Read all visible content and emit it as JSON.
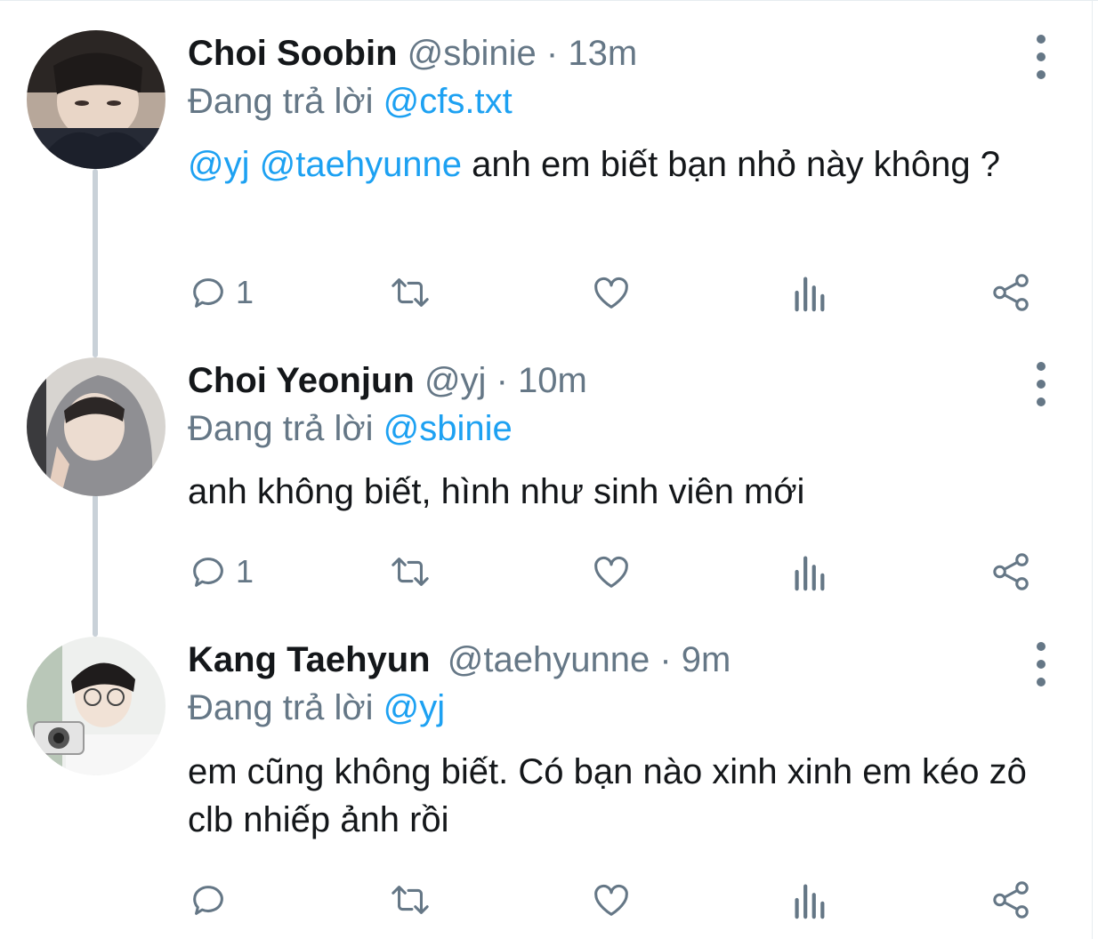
{
  "labels": {
    "replying_prefix": "Đang trả lời",
    "dot": "·"
  },
  "colors": {
    "mention": "#1da1f2",
    "secondary": "#657786",
    "thread_line": "#c9d1d8"
  },
  "tweets": [
    {
      "name": "Choi Soobin",
      "handle": "@sbinie",
      "time": "13m",
      "replying_to": "@cfs.txt",
      "body_mentions": "@yj @taehyunne",
      "body_text": " anh em biết bạn nhỏ này không ?",
      "reply_count": "1",
      "avatar_icon": "avatar-photo-icon"
    },
    {
      "name": "Choi Yeonjun",
      "handle": "@yj",
      "time": "10m",
      "replying_to": "@sbinie",
      "body_mentions": "",
      "body_text": "anh không biết, hình như sinh viên mới",
      "reply_count": "1",
      "avatar_icon": "avatar-photo-icon"
    },
    {
      "name": "Kang Taehyun",
      "handle": "@taehyunne",
      "time": "9m",
      "replying_to": "@yj",
      "body_mentions": "",
      "body_text": "em cũng không biết. Có bạn nào xinh xinh em kéo zô clb nhiếp ảnh rồi",
      "reply_count": "",
      "avatar_icon": "avatar-photo-icon"
    }
  ],
  "action_icons": [
    "reply-icon",
    "retweet-icon",
    "like-icon",
    "analytics-icon",
    "share-icon"
  ]
}
